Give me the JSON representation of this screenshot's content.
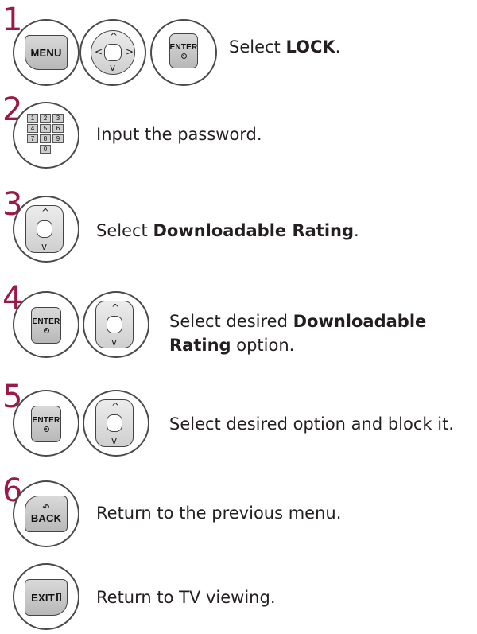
{
  "steps": [
    {
      "number": "1",
      "keys": [
        "MENU",
        "navigation pad",
        "ENTER"
      ],
      "text_before": "Select ",
      "bold": "LOCK",
      "text_after": "."
    },
    {
      "number": "2",
      "keys": [
        "number keypad"
      ],
      "text_before": "Input the password.",
      "bold": "",
      "text_after": ""
    },
    {
      "number": "3",
      "keys": [
        "up down pad"
      ],
      "text_before": "Select ",
      "bold": "Downloadable Rating",
      "text_after": "."
    },
    {
      "number": "4",
      "keys": [
        "ENTER",
        "up down pad"
      ],
      "text_before": "Select desired ",
      "bold": "Downloadable",
      "line2_bold": "Rating",
      "text_after": " option."
    },
    {
      "number": "5",
      "keys": [
        "ENTER",
        "up down pad"
      ],
      "text_before": "Select desired option and block it.",
      "bold": "",
      "text_after": ""
    },
    {
      "number": "6",
      "keys": [
        "BACK"
      ],
      "text_before": "Return to the previous menu.",
      "bold": "",
      "text_after": ""
    },
    {
      "number": "",
      "keys": [
        "EXIT"
      ],
      "text_before": "Return to TV viewing.",
      "bold": "",
      "text_after": ""
    }
  ],
  "keys": {
    "menu": "MENU",
    "enter": "ENTER",
    "back": "BACK",
    "exit": "EXIT",
    "numpad": [
      "1",
      "2",
      "3",
      "4",
      "5",
      "6",
      "7",
      "8",
      "9",
      "0"
    ]
  },
  "colors": {
    "step_number": "#9c1848",
    "key_gray": "#c8c8c8",
    "text": "#231f20"
  }
}
